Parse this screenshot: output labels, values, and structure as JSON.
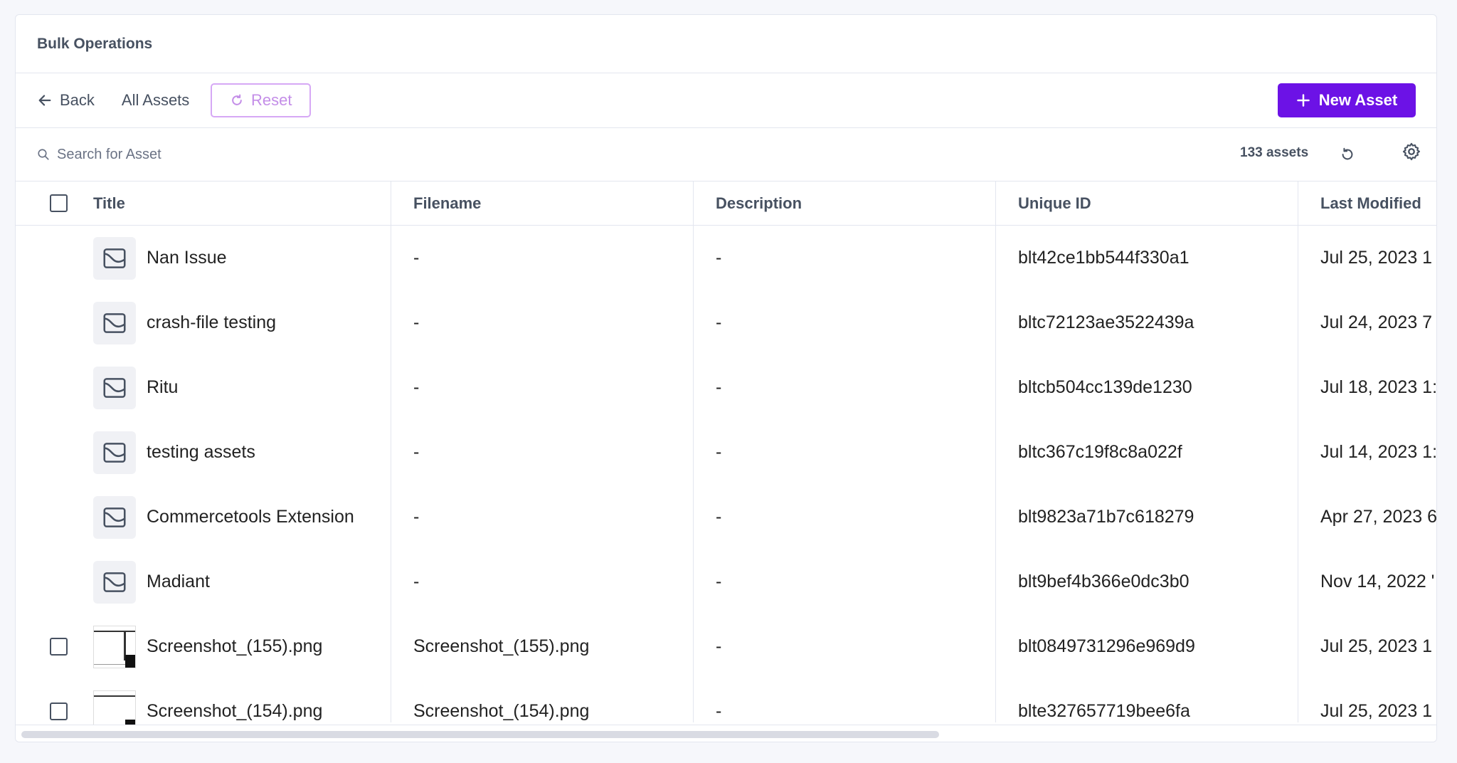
{
  "header": {
    "title": "Bulk Operations"
  },
  "toolbar": {
    "back_label": "Back",
    "all_assets_label": "All Assets",
    "reset_label": "Reset",
    "new_asset_label": "New Asset"
  },
  "search": {
    "placeholder": "Search for Asset",
    "count_label": "133 assets"
  },
  "colors": {
    "accent": "#6c12e6",
    "reset_border": "#d6a8f5",
    "text_muted": "#475161"
  },
  "table": {
    "columns": [
      "Title",
      "Filename",
      "Description",
      "Unique ID",
      "Last Modified"
    ],
    "rows": [
      {
        "type": "folder",
        "title": "Nan Issue",
        "filename": "-",
        "description": "-",
        "uid": "blt42ce1bb544f330a1",
        "modified": "Jul 25, 2023 1"
      },
      {
        "type": "folder",
        "title": "crash-file testing",
        "filename": "-",
        "description": "-",
        "uid": "bltc72123ae3522439a",
        "modified": "Jul 24, 2023 7"
      },
      {
        "type": "folder",
        "title": "Ritu",
        "filename": "-",
        "description": "-",
        "uid": "bltcb504cc139de1230",
        "modified": "Jul 18, 2023 1:"
      },
      {
        "type": "folder",
        "title": "testing assets",
        "filename": "-",
        "description": "-",
        "uid": "bltc367c19f8c8a022f",
        "modified": "Jul 14, 2023 1:"
      },
      {
        "type": "folder",
        "title": "Commercetools Extension",
        "filename": "-",
        "description": "-",
        "uid": "blt9823a71b7c618279",
        "modified": "Apr 27, 2023 6"
      },
      {
        "type": "folder",
        "title": "Madiant",
        "filename": "-",
        "description": "-",
        "uid": "blt9bef4b366e0dc3b0",
        "modified": "Nov 14, 2022 '"
      },
      {
        "type": "file",
        "title": "Screenshot_(155).png",
        "filename": "Screenshot_(155).png",
        "description": "-",
        "uid": "blt0849731296e969d9",
        "modified": "Jul 25, 2023 1"
      },
      {
        "type": "file",
        "title": "Screenshot_(154).png",
        "filename": "Screenshot_(154).png",
        "description": "-",
        "uid": "blte327657719bee6fa",
        "modified": "Jul 25, 2023 1"
      }
    ]
  }
}
